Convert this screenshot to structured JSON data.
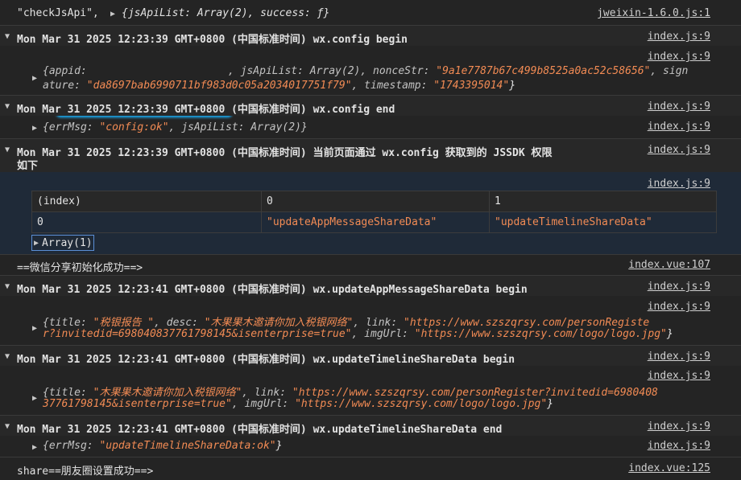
{
  "lines": {
    "l0": {
      "prefix": "\"checkJsApi\",",
      "body": "{jsApiList: Array(2), success: ƒ}",
      "source": "jweixin-1.6.0.js:1"
    },
    "g1": {
      "title": "Mon Mar 31 2025 12:23:39 GMT+0800 (中国标准时间) wx.config begin",
      "source": "index.js:9"
    },
    "o1": {
      "source": "index.js:9",
      "k_appid": "{appid:",
      "k_jsApiList": ", jsApiList: Array(2), nonceStr: ",
      "v_nonce": "\"9a1e7787b67c499b8525a0ac52c58656\"",
      "k_sign": ", sign",
      "line2_a": "ature: ",
      "v_signature": "\"da8697bab6990711bf983d0c05a2034017751f79\"",
      "k_timestamp": ", timestamp: ",
      "v_timestamp": "\"1743395014\"",
      "close": "}"
    },
    "g2": {
      "title": "Mon Mar 31 2025 12:23:39 GMT+0800 (中国标准时间) wx.config end",
      "source": "index.js:9"
    },
    "o2": {
      "k_errMsg": "{errMsg: ",
      "v_errMsg": "\"config:ok\"",
      "rest": ", jsApiList: Array(2)}",
      "source": "index.js:9"
    },
    "g3": {
      "title": "Mon Mar 31 2025 12:23:39 GMT+0800 (中国标准时间) 当前页面通过 wx.config 获取到的 JSSDK 权限",
      "title2": "如下",
      "source": "index.js:9"
    },
    "tablesrc": "index.js:9",
    "table": {
      "headers": [
        "(index)",
        "0",
        "1"
      ],
      "row_index": "0",
      "row_vals": [
        "\"updateAppMessageShareData\"",
        "\"updateTimelineShareData\""
      ]
    },
    "array_label": "Array(1)",
    "l4": {
      "text": "==微信分享初始化成功==>",
      "source": "index.vue:107"
    },
    "g5": {
      "title": "Mon Mar 31 2025 12:23:41 GMT+0800 (中国标准时间) wx.updateAppMessageShareData begin",
      "source": "index.js:9"
    },
    "o5": {
      "source": "index.js:9",
      "k_title": "{title: ",
      "v_title": "\"税银报告 \"",
      "k_desc": ", desc: ",
      "v_desc": "\"木果果木邀请你加入税银网络\"",
      "k_link": ", link: ",
      "v_link1": "\"https://www.szszqrsy.com/personRegiste",
      "v_link2": "r?invitedid=698040837761798145&isenterprise=true\"",
      "k_img": ", imgUrl: ",
      "v_img": "\"https://www.szszqrsy.com/logo/logo.jpg\"",
      "close": "}"
    },
    "g6": {
      "title": "Mon Mar 31 2025 12:23:41 GMT+0800 (中国标准时间) wx.updateTimelineShareData begin",
      "source": "index.js:9"
    },
    "o6": {
      "source": "index.js:9",
      "k_title": "{title: ",
      "v_title": "\"木果果木邀请你加入税银网络\"",
      "k_link": ", link: ",
      "v_link1": "\"https://www.szszqrsy.com/personRegister?invitedid=6980408",
      "v_link2": "37761798145&isenterprise=true\"",
      "k_img": ", imgUrl: ",
      "v_img": "\"https://www.szszqrsy.com/logo/logo.jpg\"",
      "close": "}"
    },
    "g7": {
      "title": "Mon Mar 31 2025 12:23:41 GMT+0800 (中国标准时间) wx.updateTimelineShareData end",
      "source": "index.js:9"
    },
    "o7": {
      "k_errMsg": "{errMsg: ",
      "v_errMsg": "\"updateTimelineShareData:ok\"",
      "close": "}",
      "source": "index.js:9"
    },
    "l8": {
      "text": "share==朋友圈设置成功==>",
      "source": "index.vue:125"
    }
  },
  "icons": {
    "collapse": "triangle-down-icon",
    "expand": "triangle-right-icon"
  },
  "colors": {
    "background": "#242424",
    "string": "#f28b54",
    "redaction": "#19b4ff"
  }
}
